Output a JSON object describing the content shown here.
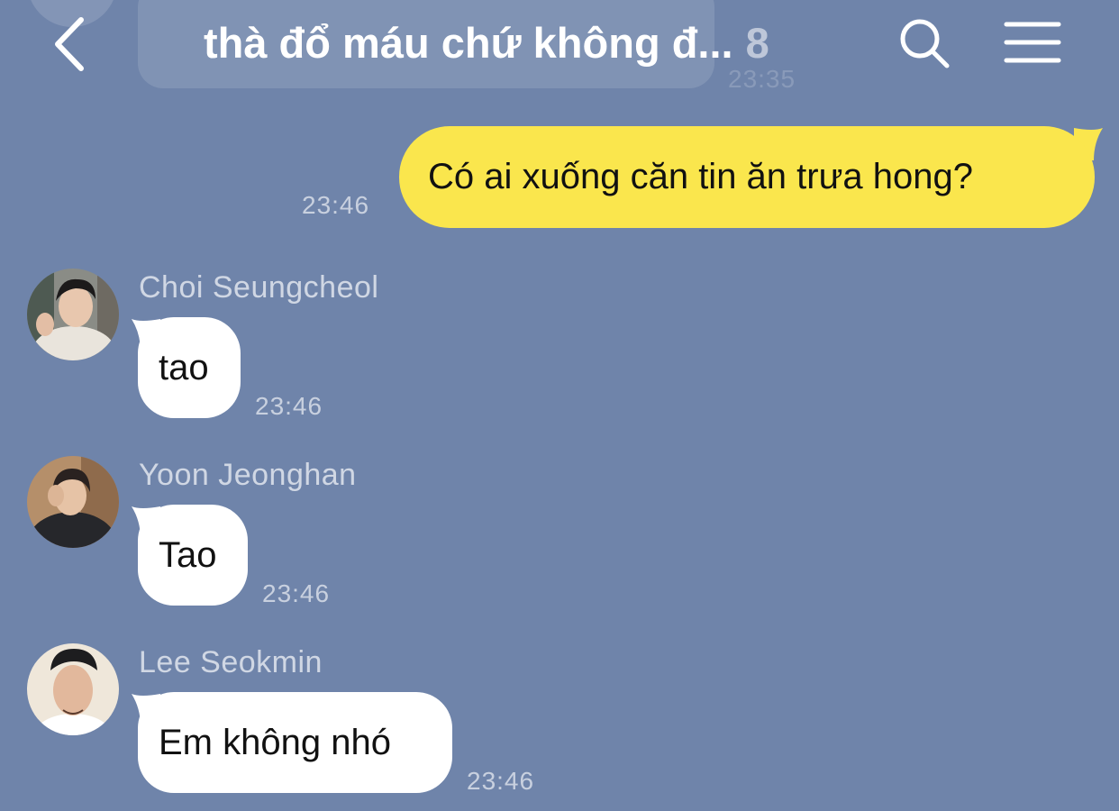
{
  "header": {
    "ghost_time": "23:35",
    "title": "thà đổ máu chứ không đ...",
    "member_count": "8"
  },
  "messages": [
    {
      "from_me": true,
      "text": "Có ai xuống căn tin ăn trưa hong?",
      "time": "23:46"
    },
    {
      "from_me": false,
      "sender": "Choi Seungcheol",
      "text": "tao",
      "time": "23:46"
    },
    {
      "from_me": false,
      "sender": "Yoon Jeonghan",
      "text": "Tao",
      "time": "23:46"
    },
    {
      "from_me": false,
      "sender": "Lee Seokmin",
      "text": "Em không nhó",
      "time": "23:46"
    }
  ],
  "colors": {
    "background": "#6f84aa",
    "my_bubble": "#fae64d",
    "their_bubble": "#ffffff"
  }
}
